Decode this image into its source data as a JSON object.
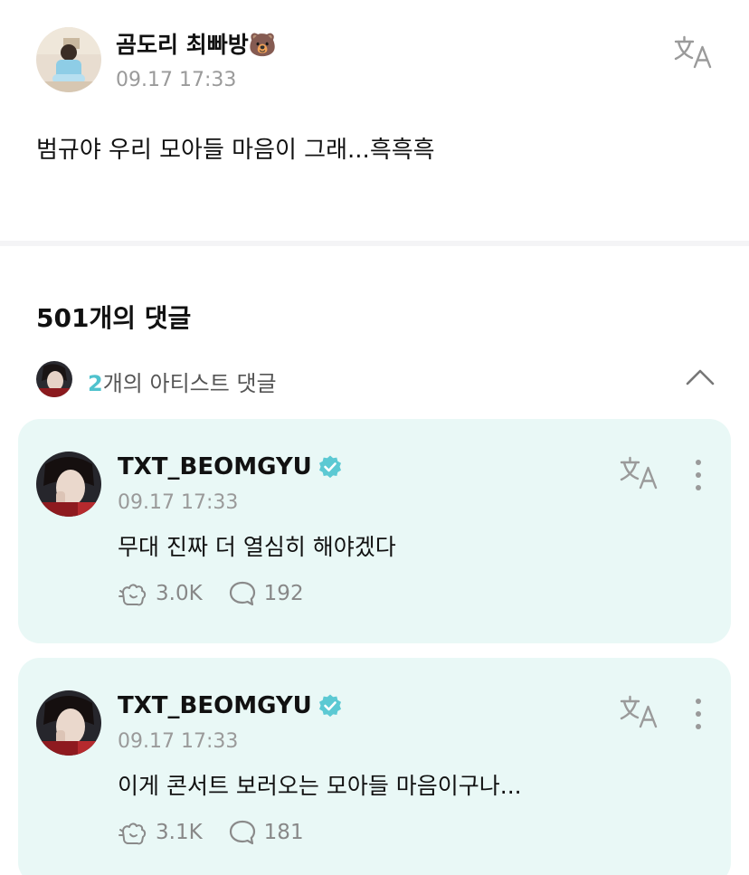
{
  "post": {
    "author": "곰도리 최빠방🐻",
    "time": "09.17 17:33",
    "body": "범규야 우리 모아들 마음이 그래...흑흑흑"
  },
  "comments_header": {
    "count_label": "501개의 댓글"
  },
  "artist_row": {
    "count": "2",
    "label": "개의 아티스트 댓글"
  },
  "comments": [
    {
      "author": "TXT_BEOMGYU",
      "time": "09.17 17:33",
      "text": "무대 진짜 더 열심히 해야겠다",
      "likes": "3.0K",
      "replies": "192"
    },
    {
      "author": "TXT_BEOMGYU",
      "time": "09.17 17:33",
      "text": "이게 콘서트 보러오는 모아들 마음이구나...",
      "likes": "3.1K",
      "replies": "181"
    }
  ],
  "colors": {
    "accent": "#4fc2cd",
    "card_bg": "#e9f8f6",
    "verified": "#5cc9d3"
  },
  "icons": {
    "translate": "translate-icon",
    "like": "like-paw-icon",
    "reply": "speech-bubble-icon",
    "more": "more-vertical-icon",
    "chevron": "chevron-up-icon",
    "verified": "verified-badge-icon"
  }
}
